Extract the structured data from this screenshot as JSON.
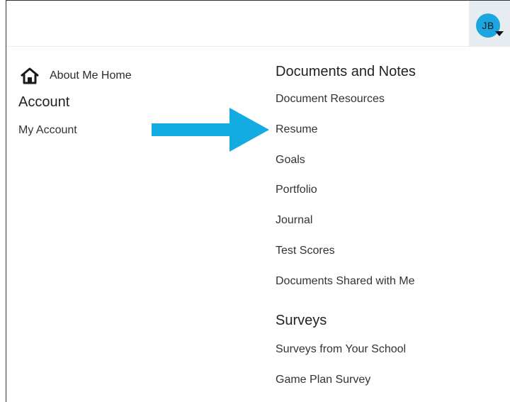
{
  "header": {
    "user_initials": "JB",
    "avatar_color": "#1ba6e0",
    "dropdown_icon": "caret-down-icon"
  },
  "left_column": {
    "home_icon": "home-icon",
    "home_label": "About Me Home",
    "account_heading": "Account",
    "account_links": [
      "My Account"
    ]
  },
  "right_column": {
    "documents_heading": "Documents and Notes",
    "documents_links": [
      "Document Resources",
      "Resume",
      "Goals",
      "Portfolio",
      "Journal",
      "Test Scores",
      "Documents Shared with Me"
    ],
    "surveys_heading": "Surveys",
    "surveys_links": [
      "Surveys from Your School",
      "Game Plan Survey"
    ]
  },
  "annotation": {
    "arrow_icon": "arrow-right-icon",
    "arrow_color": "#12ace3"
  }
}
